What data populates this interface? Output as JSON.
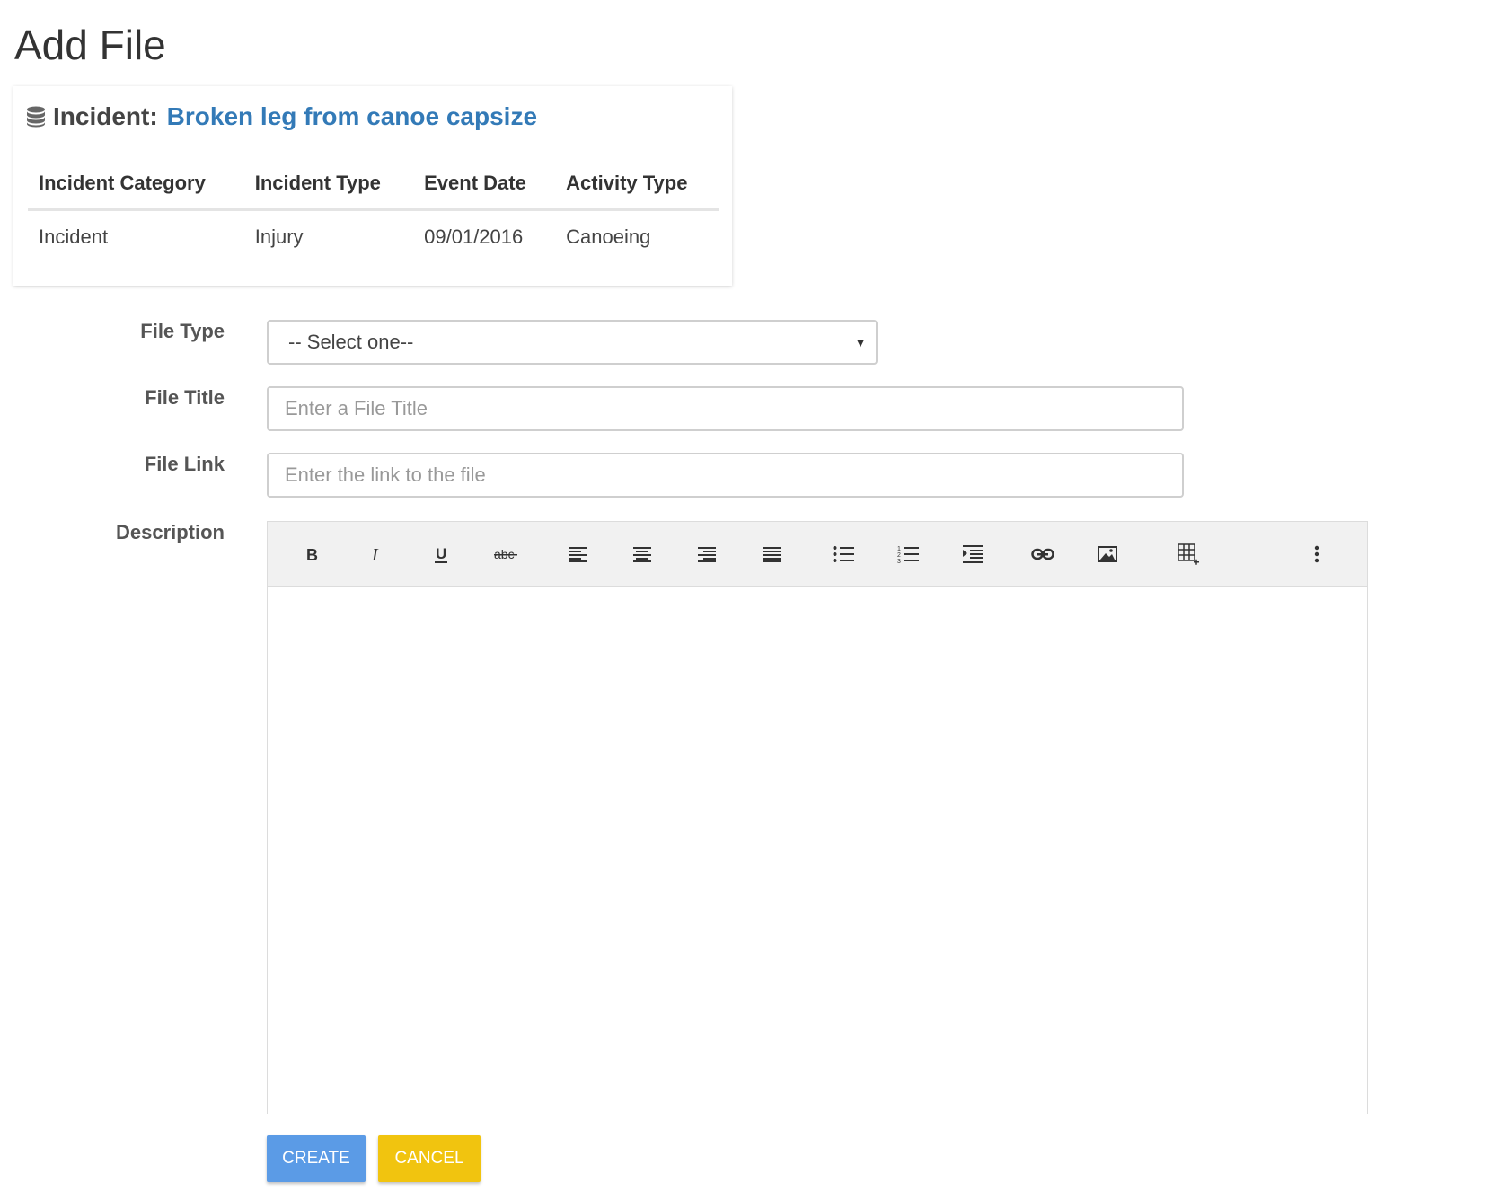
{
  "page": {
    "title": "Add File"
  },
  "incident": {
    "prefix": "Incident:",
    "title": "Broken leg from canoe capsize",
    "link_color": "#337ab7",
    "columns": [
      "Incident Category",
      "Incident Type",
      "Event Date",
      "Activity Type"
    ],
    "row": [
      "Incident",
      "Injury",
      "09/01/2016",
      "Canoeing"
    ]
  },
  "form": {
    "file_type": {
      "label": "File Type",
      "selected": "-- Select one--"
    },
    "file_title": {
      "label": "File Title",
      "placeholder": "Enter a File Title",
      "value": ""
    },
    "file_link": {
      "label": "File Link",
      "placeholder": "Enter the link to the file",
      "value": ""
    },
    "description": {
      "label": "Description",
      "toolbar": [
        "bold-icon",
        "italic-icon",
        "underline-icon",
        "strikethrough-icon",
        "align-left-icon",
        "align-center-icon",
        "align-right-icon",
        "align-justify-icon",
        "bullet-list-icon",
        "numbered-list-icon",
        "indent-icon",
        "link-icon",
        "image-icon",
        "table-icon",
        "more-icon"
      ],
      "content": ""
    }
  },
  "buttons": {
    "create": {
      "label": "CREATE",
      "color": "#5b9be6"
    },
    "cancel": {
      "label": "CANCEL",
      "color": "#f1c40f"
    }
  }
}
